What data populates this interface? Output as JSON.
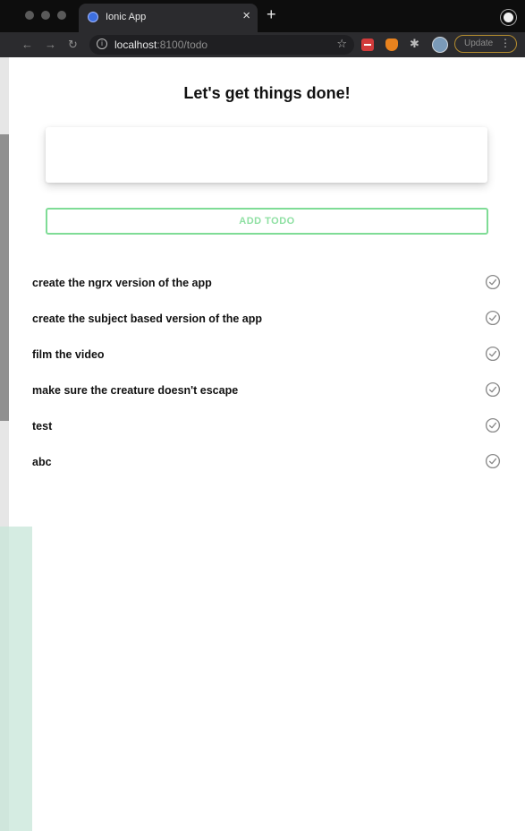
{
  "browser": {
    "tab_title": "Ionic App",
    "tab_close": "×",
    "new_tab": "+",
    "url_host": "localhost",
    "url_path": ":8100/todo",
    "update_label": "Update",
    "update_menu": "⋮",
    "accent_update_border": "#b58d2e"
  },
  "app": {
    "title": "Let's get things done!",
    "input_value": "",
    "add_button_label": "ADD TODO",
    "accent_color": "#7fdc96",
    "todos": [
      {
        "text": "create the ngrx version of the app",
        "icon": "checkmark-circle-icon"
      },
      {
        "text": "create the subject based version of the app",
        "icon": "checkmark-circle-icon"
      },
      {
        "text": "film the video",
        "icon": "checkmark-circle-icon"
      },
      {
        "text": "make sure the creature doesn't escape",
        "icon": "checkmark-circle-icon"
      },
      {
        "text": "test",
        "icon": "checkmark-circle-icon"
      },
      {
        "text": "abc",
        "icon": "checkmark-circle-icon"
      }
    ]
  }
}
